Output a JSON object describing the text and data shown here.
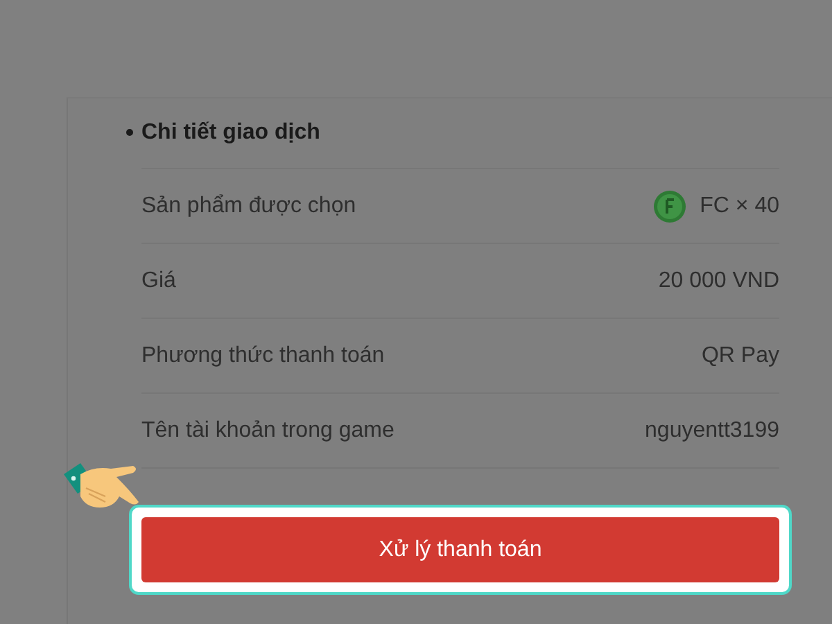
{
  "section": {
    "title": "Chi tiết giao dịch"
  },
  "rows": [
    {
      "kind": "coin",
      "label": "Sản phẩm được chọn",
      "value": "FC × 40"
    },
    {
      "kind": "text",
      "label": "Giá",
      "value": "20 000 VND"
    },
    {
      "kind": "text",
      "label": "Phương thức thanh toán",
      "value": "QR Pay"
    },
    {
      "kind": "text",
      "label": "Tên tài khoản trong game",
      "value": "nguyentt3199"
    }
  ],
  "action": {
    "label": "Xử lý thanh toán",
    "highlighted": true
  }
}
